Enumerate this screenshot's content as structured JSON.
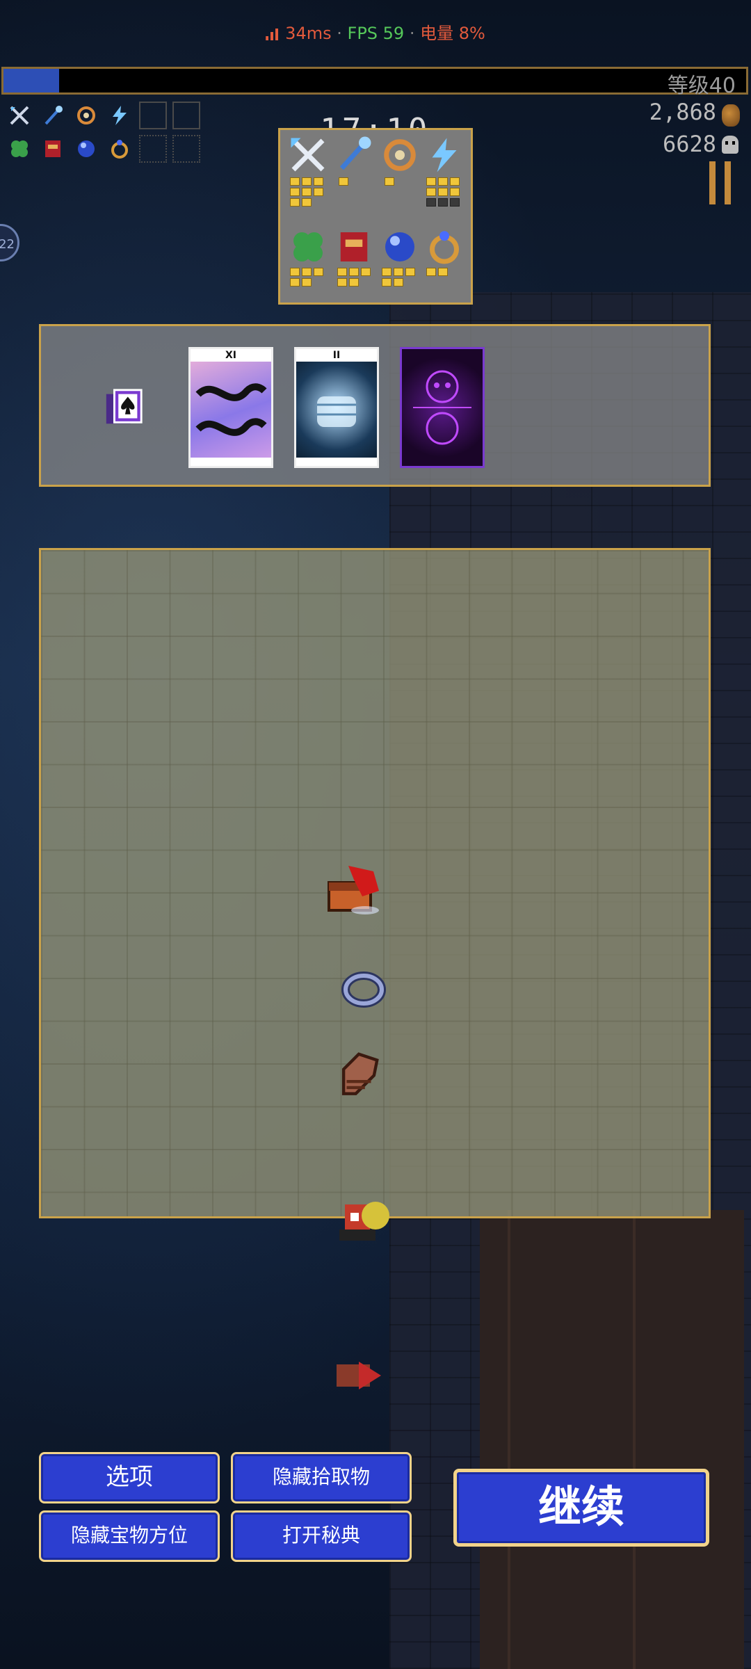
{
  "status_bar": {
    "ping": "34ms",
    "fps": "FPS 59",
    "battery": "电量 8%",
    "separator": "·"
  },
  "hud": {
    "level_label": "等级40",
    "xp_progress": 0.075,
    "timer": "17:10",
    "coins": "2,868",
    "kills": "6628",
    "side_badge": "22",
    "weapon_slots": [
      "crossed-swords-icon",
      "magic-wand-icon",
      "garlic-ring-icon",
      "lightning-icon",
      "empty",
      "empty"
    ],
    "passive_slots": [
      "clover-icon",
      "tome-icon",
      "orb-icon",
      "ring-icon",
      "empty",
      "empty"
    ]
  },
  "arcana_panel": {
    "cards": [
      {
        "numeral": "XI",
        "name": "arcana-card-xi"
      },
      {
        "numeral": "II",
        "name": "arcana-card-ii"
      },
      {
        "numeral": "",
        "name": "arcana-card-back"
      }
    ]
  },
  "map": {
    "items": [
      "treasure-chest-icon",
      "ring-icon",
      "gauntlet-icon"
    ]
  },
  "buttons": {
    "options": "选项",
    "hide_pickups": "隐藏拾取物",
    "hide_treasure": "隐藏宝物方位",
    "open_codex": "打开秘典",
    "continue": "继续"
  },
  "colors": {
    "accent_gold": "#caa24a",
    "button_blue": "#2c3ed0",
    "xp_blue": "#2d4fb6"
  }
}
